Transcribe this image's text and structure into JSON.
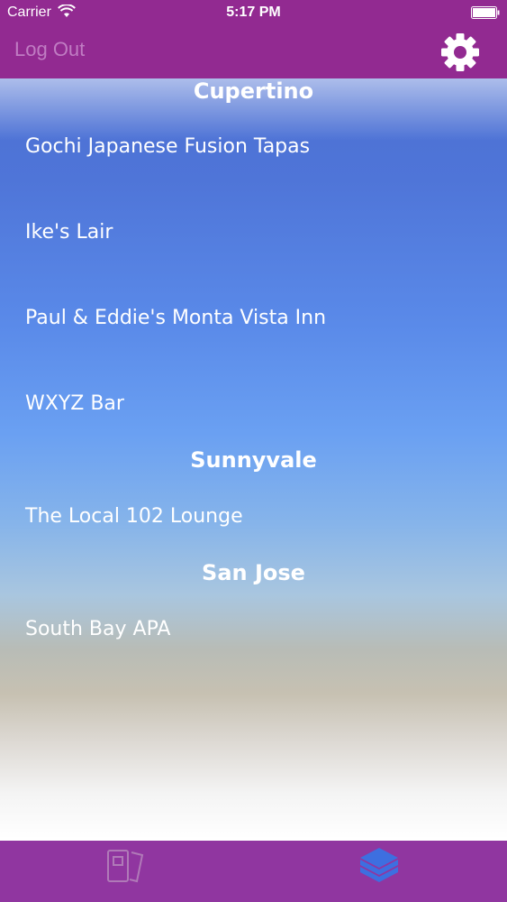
{
  "status_bar": {
    "carrier": "Carrier",
    "time": "5:17 PM",
    "icons": [
      "wifi-icon",
      "battery-icon"
    ]
  },
  "nav_bar": {
    "logout_label": "Log Out",
    "settings_icon": "gear-icon"
  },
  "sections": [
    {
      "title": "Cupertino",
      "items": [
        "Gochi Japanese Fusion Tapas",
        "Ike's Lair",
        "Paul & Eddie's Monta Vista Inn",
        "WXYZ Bar"
      ]
    },
    {
      "title": "Sunnyvale",
      "items": [
        "The Local 102 Lounge"
      ]
    },
    {
      "title": "San Jose",
      "items": [
        "South Bay APA"
      ]
    }
  ],
  "tab_bar": {
    "tabs": [
      {
        "icon": "cards-icon",
        "selected": false
      },
      {
        "icon": "layers-icon",
        "selected": true
      }
    ]
  },
  "colors": {
    "brand_purple": "#922a91",
    "tab_bar_purple": "#9036a0",
    "selected_tab_icon": "#3d6fe0",
    "unselected_tab_icon": "#b07ab8"
  }
}
